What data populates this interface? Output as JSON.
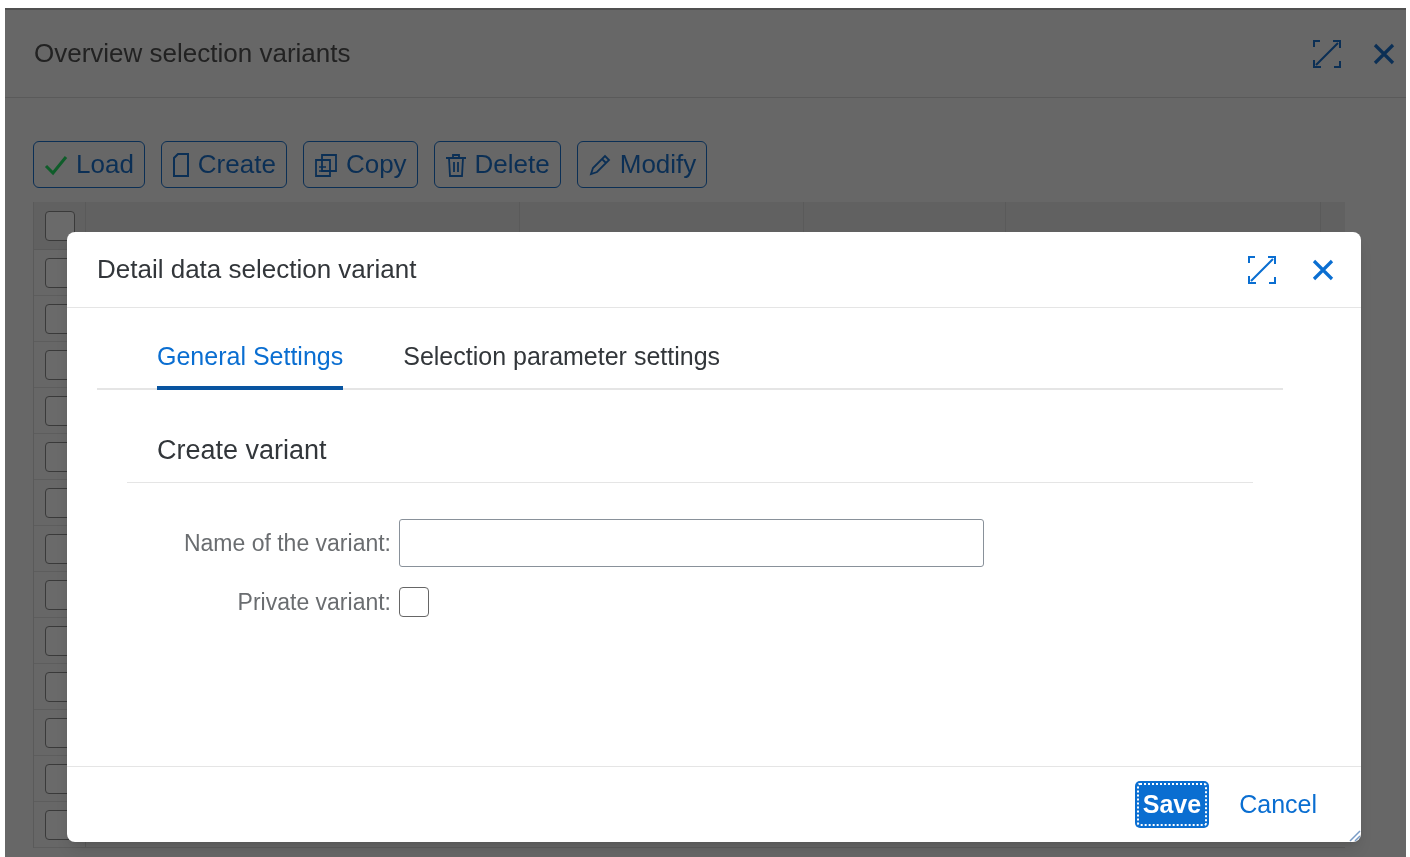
{
  "window": {
    "title": "Overview selection variants"
  },
  "toolbar": [
    {
      "label": "Load",
      "kind": "load"
    },
    {
      "label": "Create",
      "kind": "create"
    },
    {
      "label": "Copy",
      "kind": "copy"
    },
    {
      "label": "Delete",
      "kind": "delete"
    },
    {
      "label": "Modify",
      "kind": "modify"
    }
  ],
  "table": {
    "select_all": {
      "checked": false
    },
    "rows": [
      {
        "checked": false
      },
      {
        "checked": false
      },
      {
        "checked": false
      },
      {
        "checked": false
      },
      {
        "checked": false
      },
      {
        "checked": false
      },
      {
        "checked": false
      },
      {
        "checked": false
      },
      {
        "checked": false
      },
      {
        "checked": false
      },
      {
        "checked": false
      },
      {
        "checked": false
      },
      {
        "checked": false
      }
    ]
  },
  "dialog": {
    "title": "Detail data selection variant",
    "tabs": [
      {
        "label": "General Settings",
        "selected": true
      },
      {
        "label": "Selection parameter settings",
        "selected": false
      }
    ],
    "section_title": "Create variant",
    "fields": [
      {
        "kind": "text",
        "label": "Name of the variant:"
      },
      {
        "kind": "checkbox",
        "label": "Private variant:",
        "checked": false
      }
    ],
    "buttons": [
      {
        "label": "Save",
        "kind": "emphasized"
      },
      {
        "label": "Cancel",
        "kind": "transparent"
      }
    ]
  }
}
